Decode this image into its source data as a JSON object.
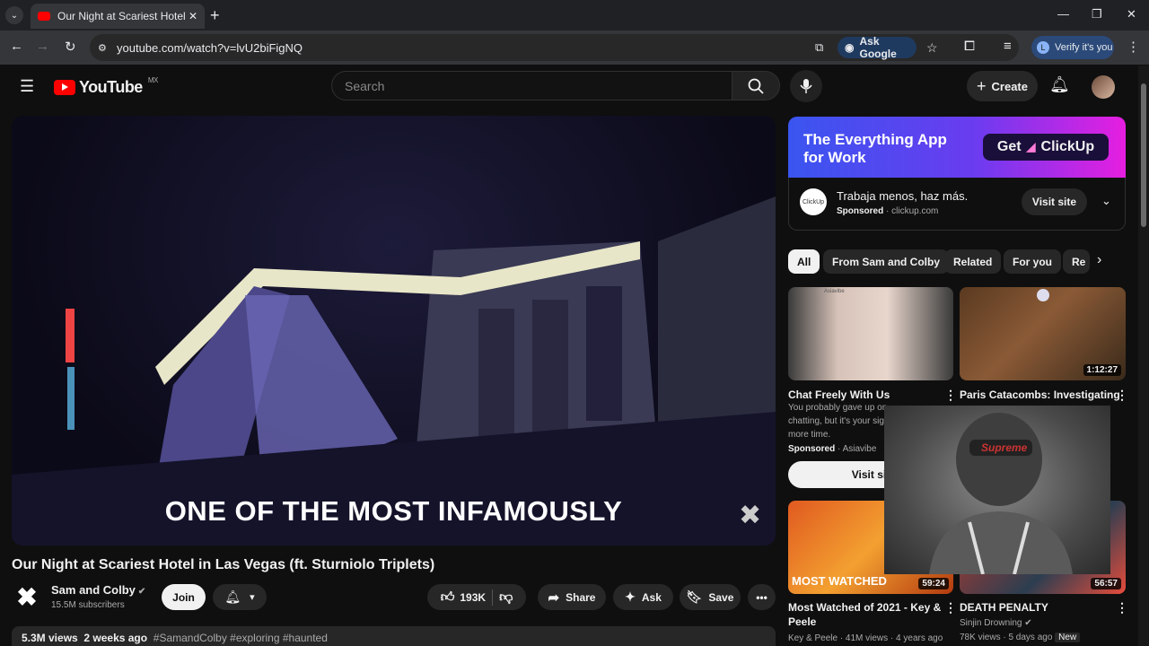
{
  "browser": {
    "tab_title": "Our Night at Scariest Hotel in L",
    "url": "youtube.com/watch?v=lvU2biFigNQ",
    "ask_google": "Ask Google",
    "verify": "Verify it's you",
    "verify_letter": "L"
  },
  "header": {
    "logo_text": "YouTube",
    "region": "MX",
    "search_placeholder": "Search",
    "create_label": "Create"
  },
  "video": {
    "caption": "ONE OF THE MOST INFAMOUSLY",
    "title": "Our Night at Scariest Hotel in Las Vegas (ft. Sturniolo Triplets)",
    "channel": "Sam and Colby",
    "subscribers": "15.5M subscribers",
    "join_label": "Join",
    "likes": "193K",
    "share_label": "Share",
    "ask_label": "Ask",
    "save_label": "Save",
    "views": "5.3M views",
    "age": "2 weeks ago",
    "tags": "#SamandColby #exploring #haunted"
  },
  "ad": {
    "headline_1": "The Everything App",
    "headline_2": "for Work",
    "cta": "Get",
    "cta_brand": "ClickUp",
    "icon_text": "ClickUp",
    "title": "Trabaja menos, haz más.",
    "sponsored": "Sponsored",
    "domain": "clickup.com",
    "visit_label": "Visit site"
  },
  "chips": [
    "All",
    "From Sam and Colby",
    "Related",
    "For you",
    "Re"
  ],
  "cards": [
    {
      "title": "Chat Freely With Us",
      "desc_1": "You probably gave up on",
      "desc_2": "chatting, but it's your sig",
      "desc_3": "more time.",
      "sponsored": "Sponsored",
      "advertiser": "Asiavibe",
      "visit": "Visit sit",
      "thumb_text": "Asiavibe"
    },
    {
      "title": "Paris Catacombs: Investigating",
      "duration": "1:12:27"
    },
    {
      "title": "Most Watched of 2021 - Key &",
      "title_2": "Peele",
      "meta": "Key & Peele · 41M views · 4 years ago",
      "duration": "59:24",
      "badge": "MOST WATCHED"
    },
    {
      "title": "DEATH PENALTY",
      "channel": "Sinjin Drowning",
      "meta": "78K views · 5 days ago",
      "new_badge": "New",
      "duration": "56:57",
      "pip_text": "Supreme"
    }
  ],
  "colors": {
    "brand_red": "#ff0000",
    "bg": "#0f0f0f",
    "chip": "#272727"
  }
}
